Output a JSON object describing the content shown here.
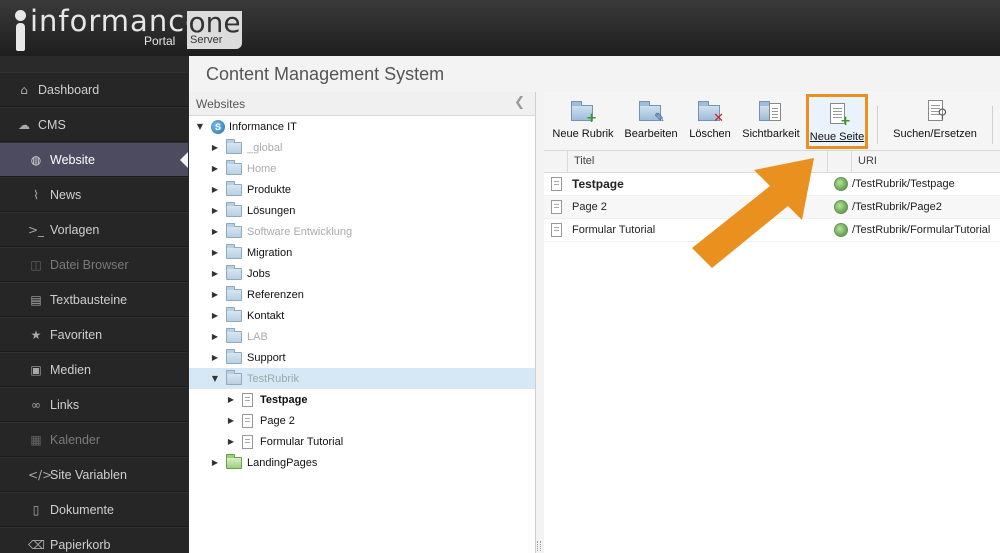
{
  "header": {
    "logo_word": "informance",
    "logo_portal": "Portal",
    "logo_one": "one",
    "logo_server": "Server"
  },
  "page_title": "Content Management System",
  "sidebar": {
    "items": [
      {
        "label": "Dashboard",
        "icon": "home-icon",
        "state": "normal"
      },
      {
        "label": "CMS",
        "icon": "cloud-icon",
        "state": "normal"
      },
      {
        "label": "Website",
        "icon": "globe-icon",
        "state": "active"
      },
      {
        "label": "News",
        "icon": "rss-icon",
        "state": "normal"
      },
      {
        "label": "Vorlagen",
        "icon": "terminal-icon",
        "state": "normal"
      },
      {
        "label": "Datei Browser",
        "icon": "columns-icon",
        "state": "dim"
      },
      {
        "label": "Textbausteine",
        "icon": "document-icon",
        "state": "normal"
      },
      {
        "label": "Favoriten",
        "icon": "star-icon",
        "state": "normal"
      },
      {
        "label": "Medien",
        "icon": "image-icon",
        "state": "normal"
      },
      {
        "label": "Links",
        "icon": "link-icon",
        "state": "normal"
      },
      {
        "label": "Kalender",
        "icon": "calendar-icon",
        "state": "dim"
      },
      {
        "label": "Site Variablen",
        "icon": "code-icon",
        "state": "normal"
      },
      {
        "label": "Dokumente",
        "icon": "file-icon",
        "state": "normal"
      },
      {
        "label": "Papierkorb",
        "icon": "trash-icon",
        "state": "normal"
      }
    ]
  },
  "tree": {
    "header": "Websites",
    "root": "Informance IT",
    "items": [
      {
        "label": "_global",
        "dim": true
      },
      {
        "label": "Home",
        "dim": true
      },
      {
        "label": "Produkte",
        "dim": false
      },
      {
        "label": "Lösungen",
        "dim": false
      },
      {
        "label": "Software Entwicklung",
        "dim": true
      },
      {
        "label": "Migration",
        "dim": false
      },
      {
        "label": "Jobs",
        "dim": false
      },
      {
        "label": "Referenzen",
        "dim": false
      },
      {
        "label": "Kontakt",
        "dim": false
      },
      {
        "label": "LAB",
        "dim": true
      },
      {
        "label": "Support",
        "dim": false
      }
    ],
    "selected": "TestRubrik",
    "children": [
      {
        "label": "Testpage",
        "bold": true
      },
      {
        "label": "Page 2",
        "bold": false
      },
      {
        "label": "Formular Tutorial",
        "bold": false
      }
    ],
    "last": "LandingPages"
  },
  "toolbar": {
    "neue_rubrik": "Neue Rubrik",
    "bearbeiten": "Bearbeiten",
    "loeschen": "Löschen",
    "sichtbarkeit": "Sichtbarkeit",
    "neue_seite": "Neue Seite",
    "suchen": "Suchen/Ersetzen"
  },
  "grid": {
    "col_title": "Titel",
    "col_uri": "URI",
    "rows": [
      {
        "title": "Testpage",
        "uri": "/TestRubrik/Testpage",
        "bold": true
      },
      {
        "title": "Page 2",
        "uri": "/TestRubrik/Page2",
        "bold": false
      },
      {
        "title": "Formular Tutorial",
        "uri": "/TestRubrik/FormularTutorial",
        "bold": false
      }
    ]
  },
  "colors": {
    "accent_orange": "#e9901e",
    "active_nav": "#4d4b60",
    "sidebar_bg": "#262626"
  }
}
